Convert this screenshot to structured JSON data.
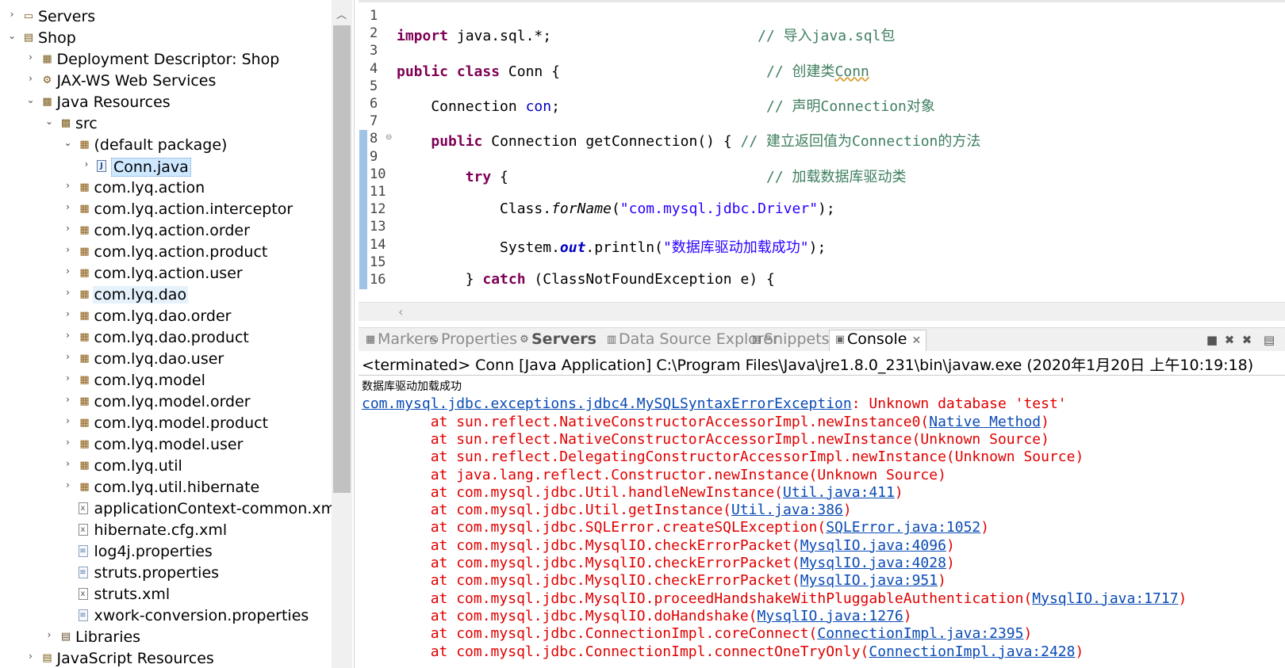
{
  "explorer": {
    "rows": [
      {
        "label": "Servers",
        "twisty": "›",
        "icon": "folder-icon",
        "glyph": "▭"
      },
      {
        "label": "Shop",
        "twisty": "⌄",
        "icon": "project-icon",
        "glyph": "▤"
      },
      {
        "label": "Deployment Descriptor: Shop",
        "twisty": "›",
        "icon": "deployment-descriptor-icon",
        "glyph": "▦"
      },
      {
        "label": "JAX-WS Web Services",
        "twisty": "›",
        "icon": "web-services-icon",
        "glyph": "⚙"
      },
      {
        "label": "Java Resources",
        "twisty": "⌄",
        "icon": "java-resources-icon",
        "glyph": "▩"
      },
      {
        "label": "src",
        "twisty": "⌄",
        "icon": "source-folder-icon",
        "glyph": "▩"
      },
      {
        "label": "(default package)",
        "twisty": "⌄",
        "icon": "package-icon",
        "glyph": "▦"
      },
      {
        "label": "Conn.java",
        "twisty": "›",
        "icon": "java-file-icon",
        "glyph": "J"
      },
      {
        "label": "com.lyq.action",
        "twisty": "›",
        "icon": "package-icon",
        "glyph": "▦"
      },
      {
        "label": "com.lyq.action.interceptor",
        "twisty": "›",
        "icon": "package-icon",
        "glyph": "▦"
      },
      {
        "label": "com.lyq.action.order",
        "twisty": "›",
        "icon": "package-icon",
        "glyph": "▦"
      },
      {
        "label": "com.lyq.action.product",
        "twisty": "›",
        "icon": "package-icon",
        "glyph": "▦"
      },
      {
        "label": "com.lyq.action.user",
        "twisty": "›",
        "icon": "package-icon",
        "glyph": "▦"
      },
      {
        "label": "com.lyq.dao",
        "twisty": "›",
        "icon": "package-icon",
        "glyph": "▦"
      },
      {
        "label": "com.lyq.dao.order",
        "twisty": "›",
        "icon": "package-icon",
        "glyph": "▦"
      },
      {
        "label": "com.lyq.dao.product",
        "twisty": "›",
        "icon": "package-icon",
        "glyph": "▦"
      },
      {
        "label": "com.lyq.dao.user",
        "twisty": "›",
        "icon": "package-icon",
        "glyph": "▦"
      },
      {
        "label": "com.lyq.model",
        "twisty": "›",
        "icon": "package-icon",
        "glyph": "▦"
      },
      {
        "label": "com.lyq.model.order",
        "twisty": "›",
        "icon": "package-icon",
        "glyph": "▦"
      },
      {
        "label": "com.lyq.model.product",
        "twisty": "›",
        "icon": "package-icon",
        "glyph": "▦"
      },
      {
        "label": "com.lyq.model.user",
        "twisty": "›",
        "icon": "package-icon",
        "glyph": "▦"
      },
      {
        "label": "com.lyq.util",
        "twisty": "›",
        "icon": "package-icon",
        "glyph": "▦"
      },
      {
        "label": "com.lyq.util.hibernate",
        "twisty": "›",
        "icon": "package-icon",
        "glyph": "▦"
      },
      {
        "label": "applicationContext-common.xml",
        "twisty": "",
        "icon": "xml-file-icon",
        "glyph": "x"
      },
      {
        "label": "hibernate.cfg.xml",
        "twisty": "",
        "icon": "xml-file-icon",
        "glyph": "x"
      },
      {
        "label": "log4j.properties",
        "twisty": "",
        "icon": "properties-file-icon",
        "glyph": "≡"
      },
      {
        "label": "struts.properties",
        "twisty": "",
        "icon": "properties-file-icon",
        "glyph": "≡"
      },
      {
        "label": "struts.xml",
        "twisty": "",
        "icon": "xml-file-icon",
        "glyph": "x"
      },
      {
        "label": "xwork-conversion.properties",
        "twisty": "",
        "icon": "properties-file-icon",
        "glyph": "≡"
      },
      {
        "label": "Libraries",
        "twisty": "›",
        "icon": "libraries-icon",
        "glyph": "▤"
      },
      {
        "label": "JavaScript Resources",
        "twisty": "›",
        "icon": "javascript-resources-icon",
        "glyph": "▤"
      }
    ]
  },
  "editor": {
    "lines": [
      {
        "num": "1",
        "tokens": []
      },
      {
        "num": "2",
        "tokens": [
          {
            "t": "kw",
            "v": "import"
          },
          {
            "t": "",
            "v": " java.sql.*;                        "
          },
          {
            "t": "cmt",
            "v": "// 导入java.sql包"
          }
        ]
      },
      {
        "num": "3",
        "tokens": []
      },
      {
        "num": "4",
        "tokens": [
          {
            "t": "kw",
            "v": "public"
          },
          {
            "t": "",
            "v": " "
          },
          {
            "t": "kw",
            "v": "class"
          },
          {
            "t": "",
            "v": " Conn {                        "
          },
          {
            "t": "cmt",
            "v": "// 创建类"
          },
          {
            "t": "cmt cn",
            "v": "Conn"
          }
        ]
      },
      {
        "num": "5",
        "tokens": []
      },
      {
        "num": "6",
        "tokens": [
          {
            "t": "",
            "v": "    Connection "
          },
          {
            "t": "fld",
            "v": "con"
          },
          {
            "t": "",
            "v": ";                        "
          },
          {
            "t": "cmt",
            "v": "// 声明Connection对象"
          }
        ]
      },
      {
        "num": "7",
        "tokens": []
      },
      {
        "num": "8",
        "tokens": [
          {
            "t": "",
            "v": "    "
          },
          {
            "t": "kw",
            "v": "public"
          },
          {
            "t": "",
            "v": " Connection getConnection() { "
          },
          {
            "t": "cmt",
            "v": "// 建立返回值为Connection的方法"
          }
        ]
      },
      {
        "num": "9",
        "tokens": []
      },
      {
        "num": "10",
        "tokens": [
          {
            "t": "",
            "v": "        "
          },
          {
            "t": "kw",
            "v": "try"
          },
          {
            "t": "",
            "v": " {                              "
          },
          {
            "t": "cmt",
            "v": "// 加载数据库驱动类"
          }
        ]
      },
      {
        "num": "11",
        "tokens": []
      },
      {
        "num": "12",
        "tokens": [
          {
            "t": "",
            "v": "            Class."
          },
          {
            "t": "ital",
            "v": "forName"
          },
          {
            "t": "",
            "v": "("
          },
          {
            "t": "str",
            "v": "\"com.mysql.jdbc.Driver\""
          },
          {
            "t": "",
            "v": ");"
          }
        ]
      },
      {
        "num": "13",
        "tokens": []
      },
      {
        "num": "14",
        "tokens": [
          {
            "t": "",
            "v": "            System."
          },
          {
            "t": "ital fld",
            "v": "out"
          },
          {
            "t": "",
            "v": ".println("
          },
          {
            "t": "str",
            "v": "\"数据库驱动加载成功\""
          },
          {
            "t": "",
            "v": ");"
          }
        ]
      },
      {
        "num": "15",
        "tokens": []
      },
      {
        "num": "16",
        "tokens": [
          {
            "t": "",
            "v": "        } "
          },
          {
            "t": "kw",
            "v": "catch"
          },
          {
            "t": "",
            "v": " (ClassNotFoundException e) {"
          }
        ]
      }
    ]
  },
  "views": {
    "tabs": [
      {
        "label": "Markers",
        "icon": "markers-icon",
        "glyph": "▦"
      },
      {
        "label": "Properties",
        "icon": "properties-icon",
        "glyph": "▭"
      },
      {
        "label": "Servers",
        "icon": "servers-icon",
        "glyph": "⚙"
      },
      {
        "label": "Data Source Explorer",
        "icon": "data-source-icon",
        "glyph": "▥"
      },
      {
        "label": "Snippets",
        "icon": "snippets-icon",
        "glyph": "▤"
      },
      {
        "label": "Console",
        "icon": "console-icon",
        "glyph": "▣"
      }
    ],
    "close_glyph": "✕",
    "toolbar": [
      {
        "icon": "terminate-icon",
        "glyph": "■"
      },
      {
        "icon": "remove-launch-icon",
        "glyph": "✖"
      },
      {
        "icon": "remove-all-icon",
        "glyph": "✖"
      },
      {
        "icon": "clear-console-icon",
        "glyph": "▤"
      }
    ]
  },
  "console": {
    "header": "<terminated> Conn [Java Application] C:\\Program Files\\Java\\jre1.8.0_231\\bin\\javaw.exe (2020年1月20日 上午10:19:18)",
    "lines": [
      {
        "cls": "out",
        "tokens": [
          {
            "t": "",
            "v": "数据库驱动加载成功"
          }
        ]
      },
      {
        "cls": "",
        "tokens": [
          {
            "t": "lnk",
            "v": "com.mysql.jdbc.exceptions.jdbc4.MySQLSyntaxErrorException"
          },
          {
            "t": "err",
            "v": ": Unknown database 'test'"
          }
        ]
      },
      {
        "cls": "",
        "tokens": [
          {
            "t": "err",
            "v": "\tat sun.reflect.NativeConstructorAccessorImpl.newInstance0("
          },
          {
            "t": "lnk",
            "v": "Native Method"
          },
          {
            "t": "err",
            "v": ")"
          }
        ]
      },
      {
        "cls": "",
        "tokens": [
          {
            "t": "err",
            "v": "\tat sun.reflect.NativeConstructorAccessorImpl.newInstance(Unknown Source)"
          }
        ]
      },
      {
        "cls": "",
        "tokens": [
          {
            "t": "err",
            "v": "\tat sun.reflect.DelegatingConstructorAccessorImpl.newInstance(Unknown Source)"
          }
        ]
      },
      {
        "cls": "",
        "tokens": [
          {
            "t": "err",
            "v": "\tat java.lang.reflect.Constructor.newInstance(Unknown Source)"
          }
        ]
      },
      {
        "cls": "",
        "tokens": [
          {
            "t": "err",
            "v": "\tat com.mysql.jdbc.Util.handleNewInstance("
          },
          {
            "t": "lnk",
            "v": "Util.java:411"
          },
          {
            "t": "err",
            "v": ")"
          }
        ]
      },
      {
        "cls": "",
        "tokens": [
          {
            "t": "err",
            "v": "\tat com.mysql.jdbc.Util.getInstance("
          },
          {
            "t": "lnk",
            "v": "Util.java:386"
          },
          {
            "t": "err",
            "v": ")"
          }
        ]
      },
      {
        "cls": "",
        "tokens": [
          {
            "t": "err",
            "v": "\tat com.mysql.jdbc.SQLError.createSQLException("
          },
          {
            "t": "lnk",
            "v": "SQLError.java:1052"
          },
          {
            "t": "err",
            "v": ")"
          }
        ]
      },
      {
        "cls": "",
        "tokens": [
          {
            "t": "err",
            "v": "\tat com.mysql.jdbc.MysqlIO.checkErrorPacket("
          },
          {
            "t": "lnk",
            "v": "MysqlIO.java:4096"
          },
          {
            "t": "err",
            "v": ")"
          }
        ]
      },
      {
        "cls": "",
        "tokens": [
          {
            "t": "err",
            "v": "\tat com.mysql.jdbc.MysqlIO.checkErrorPacket("
          },
          {
            "t": "lnk",
            "v": "MysqlIO.java:4028"
          },
          {
            "t": "err",
            "v": ")"
          }
        ]
      },
      {
        "cls": "",
        "tokens": [
          {
            "t": "err",
            "v": "\tat com.mysql.jdbc.MysqlIO.checkErrorPacket("
          },
          {
            "t": "lnk",
            "v": "MysqlIO.java:951"
          },
          {
            "t": "err",
            "v": ")"
          }
        ]
      },
      {
        "cls": "",
        "tokens": [
          {
            "t": "err",
            "v": "\tat com.mysql.jdbc.MysqlIO.proceedHandshakeWithPluggableAuthentication("
          },
          {
            "t": "lnk",
            "v": "MysqlIO.java:1717"
          },
          {
            "t": "err",
            "v": ")"
          }
        ]
      },
      {
        "cls": "",
        "tokens": [
          {
            "t": "err",
            "v": "\tat com.mysql.jdbc.MysqlIO.doHandshake("
          },
          {
            "t": "lnk",
            "v": "MysqlIO.java:1276"
          },
          {
            "t": "err",
            "v": ")"
          }
        ]
      },
      {
        "cls": "",
        "tokens": [
          {
            "t": "err",
            "v": "\tat com.mysql.jdbc.ConnectionImpl.coreConnect("
          },
          {
            "t": "lnk",
            "v": "ConnectionImpl.java:2395"
          },
          {
            "t": "err",
            "v": ")"
          }
        ]
      },
      {
        "cls": "",
        "tokens": [
          {
            "t": "err",
            "v": "\tat com.mysql.jdbc.ConnectionImpl.connectOneTryOnly("
          },
          {
            "t": "lnk",
            "v": "ConnectionImpl.java:2428"
          },
          {
            "t": "err",
            "v": ")"
          }
        ]
      }
    ]
  },
  "colors": {
    "keyword": "#7f0055",
    "comment": "#3f7f5f",
    "string": "#2a00ff",
    "field": "#0000c0",
    "error": "#e00000",
    "link": "#0a4bb5",
    "selection": "#cde8ff"
  }
}
